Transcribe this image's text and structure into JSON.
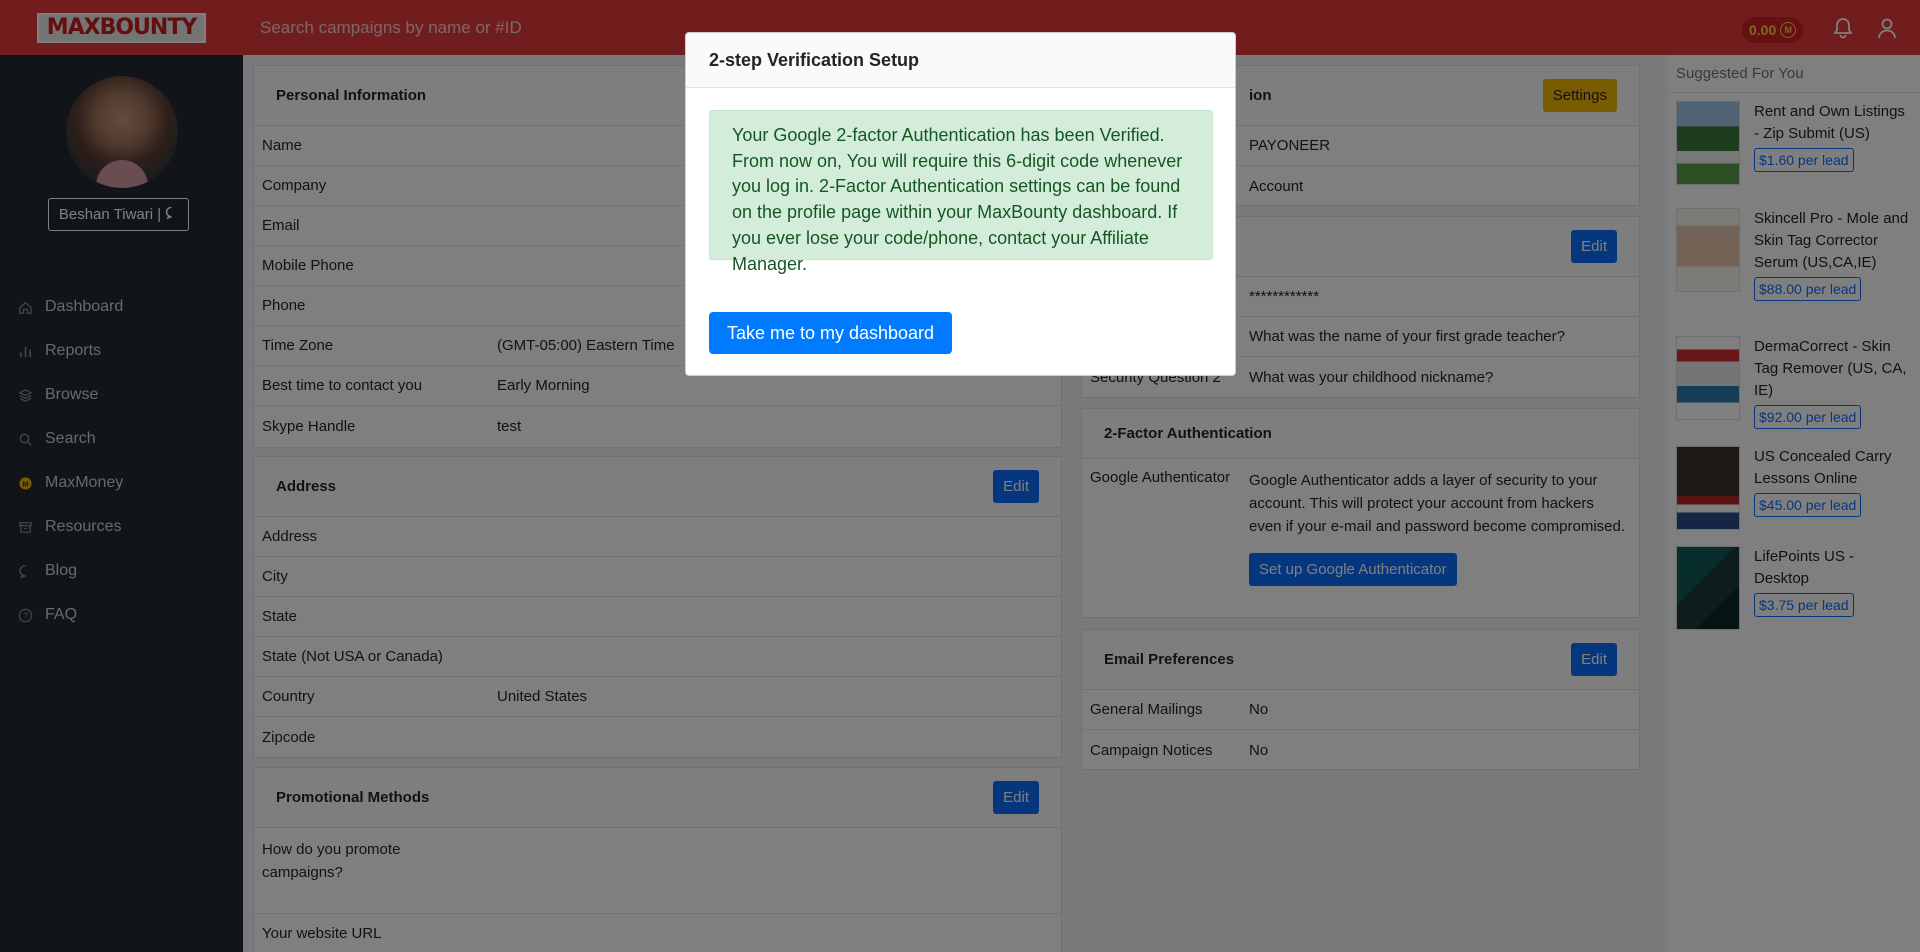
{
  "header": {
    "logo": "MAXBOUNTY",
    "search_placeholder": "Search campaigns by name or #ID",
    "balance": "0.00",
    "balance_coin": "M"
  },
  "sidebar": {
    "user_name": "Beshan Tiwari |",
    "items": [
      {
        "label": "Dashboard",
        "icon": "home-icon"
      },
      {
        "label": "Reports",
        "icon": "bar-chart-icon"
      },
      {
        "label": "Browse",
        "icon": "layers-icon"
      },
      {
        "label": "Search",
        "icon": "search-icon"
      },
      {
        "label": "MaxMoney",
        "icon": "maxmoney-coin-icon"
      },
      {
        "label": "Resources",
        "icon": "archive-icon"
      },
      {
        "label": "Blog",
        "icon": "chat-icon"
      },
      {
        "label": "FAQ",
        "icon": "question-icon"
      }
    ]
  },
  "personal": {
    "title": "Personal Information",
    "rows": [
      {
        "k": "Name",
        "v": ""
      },
      {
        "k": "Company",
        "v": ""
      },
      {
        "k": "Email",
        "v": ""
      },
      {
        "k": "Mobile Phone",
        "v": ""
      },
      {
        "k": "Phone",
        "v": ""
      },
      {
        "k": "Time Zone",
        "v": "(GMT-05:00) Eastern Time"
      },
      {
        "k": "Best time to contact you",
        "v": "Early Morning"
      },
      {
        "k": "Skype Handle",
        "v": "test"
      }
    ]
  },
  "address": {
    "title": "Address",
    "edit": "Edit",
    "rows": [
      {
        "k": "Address",
        "v": ""
      },
      {
        "k": "City",
        "v": ""
      },
      {
        "k": "State",
        "v": ""
      },
      {
        "k": "State (Not USA or Canada)",
        "v": ""
      },
      {
        "k": "Country",
        "v": "United States"
      },
      {
        "k": "Zipcode",
        "v": ""
      }
    ]
  },
  "promo": {
    "title": "Promotional Methods",
    "edit": "Edit",
    "rows": [
      {
        "k": "How do you promote campaigns?",
        "v": ""
      },
      {
        "k": "Your website URL",
        "v": ""
      }
    ]
  },
  "payment": {
    "title_fragment": "ion",
    "settings": "Settings",
    "rows": [
      {
        "k": "",
        "v": "PAYONEER"
      },
      {
        "k": "",
        "v": "Account"
      }
    ]
  },
  "security": {
    "edit": "Edit",
    "rows": [
      {
        "k": "",
        "v": "************"
      },
      {
        "k": "",
        "v": "What was the name of your first grade teacher?"
      },
      {
        "k": "Security Question 2",
        "v": "What was your childhood nickname?"
      }
    ]
  },
  "twofa": {
    "title": "2-Factor Authentication",
    "label": "Google Authenticator",
    "description": "Google Authenticator adds a layer of security to your account. This will protect your account from hackers even if your e-mail and password become compromised.",
    "setup_button": "Set up Google Authenticator"
  },
  "email_prefs": {
    "title": "Email Preferences",
    "edit": "Edit",
    "rows": [
      {
        "k": "General Mailings",
        "v": "No"
      },
      {
        "k": "Campaign Notices",
        "v": "No"
      }
    ]
  },
  "suggested": {
    "title": "Suggested For You",
    "items": [
      {
        "name": "Rent and Own Listings - Zip Submit (US)",
        "price": "$1.60 per lead"
      },
      {
        "name": "Skincell Pro - Mole and Skin Tag Corrector Serum (US,CA,IE)",
        "price": "$88.00 per lead"
      },
      {
        "name": "DermaCorrect - Skin Tag Remover (US, CA, IE)",
        "price": "$92.00 per lead"
      },
      {
        "name": "US Concealed Carry Lessons Online",
        "price": "$45.00 per lead"
      },
      {
        "name": "LifePoints US - Desktop",
        "price": "$3.75 per lead"
      }
    ]
  },
  "modal": {
    "title": "2-step Verification Setup",
    "message": "Your Google 2-factor Authentication has been Verified. From now on, You will require this 6-digit code whenever you log in. 2-Factor Authentication settings can be found on the profile page within your MaxBounty dashboard. If you ever lose your code/phone, contact your Affiliate Manager.",
    "button": "Take me to my dashboard"
  },
  "colors": {
    "header_red": "#e43b3b",
    "sidebar_dark": "#232a32",
    "primary_blue": "#0d6efd",
    "settings_yellow": "#f2b705",
    "alert_green_bg": "#d4edda",
    "alert_green_text": "#155724"
  }
}
